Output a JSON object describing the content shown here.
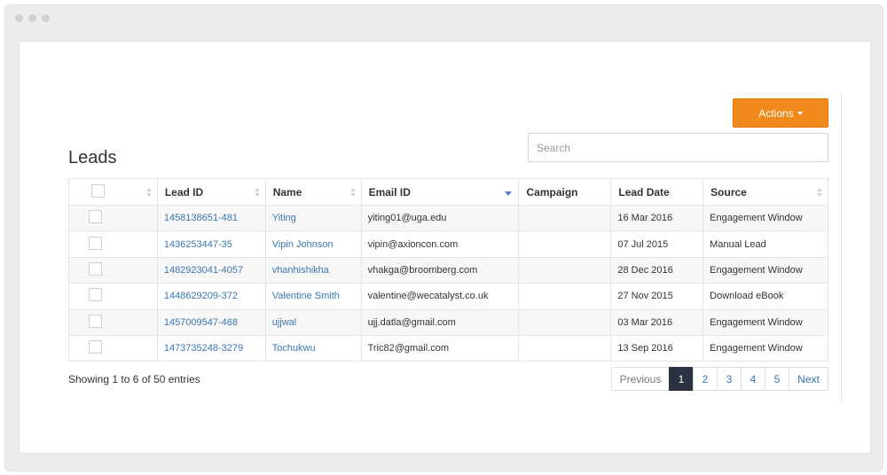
{
  "actions": {
    "label": "Actions"
  },
  "page": {
    "title": "Leads"
  },
  "search": {
    "placeholder": "Search",
    "value": ""
  },
  "table": {
    "columns": [
      "Lead ID",
      "Name",
      "Email ID",
      "Campaign",
      "Lead Date",
      "Source"
    ],
    "rows": [
      {
        "lead_id": "1458138651-481",
        "name": "Yiting",
        "email": "yiting01@uga.edu",
        "campaign": "",
        "date": "16 Mar 2016",
        "source": "Engagement Window"
      },
      {
        "lead_id": "1436253447-35",
        "name": "Vipin Johnson",
        "email": "vipin@axioncon.com",
        "campaign": "",
        "date": "07 Jul 2015",
        "source": "Manual Lead"
      },
      {
        "lead_id": "1482923041-4057",
        "name": "vhanhishikha",
        "email": "vhakga@broomberg.com",
        "campaign": "",
        "date": "28 Dec 2016",
        "source": "Engagement Window"
      },
      {
        "lead_id": "1448629209-372",
        "name": "Valentine Smith",
        "email": "valentine@wecatalyst.co.uk",
        "campaign": "",
        "date": "27 Nov 2015",
        "source": "Download eBook"
      },
      {
        "lead_id": "1457009547-468",
        "name": "ujjwal",
        "email": "ujj.datla@gmail.com",
        "campaign": "",
        "date": "03 Mar 2016",
        "source": "Engagement Window"
      },
      {
        "lead_id": "1473735248-3279",
        "name": "Tochukwu",
        "email": "Tric82@gmail.com",
        "campaign": "",
        "date": "13 Sep 2016",
        "source": "Engagement Window"
      }
    ]
  },
  "footer": {
    "entries_text": "Showing 1 to 6 of 50 entries"
  },
  "pagination": {
    "previous": "Previous",
    "pages": [
      "1",
      "2",
      "3",
      "4",
      "5"
    ],
    "active_page": "1",
    "next": "Next"
  },
  "colors": {
    "accent": "#f08a1c",
    "link": "#3a77b0",
    "active_page": "#2b3340",
    "sort_active": "#5a7bc6"
  },
  "icons": {
    "sort": "sort-icon",
    "sort_active": "sort-desc-icon",
    "dropdown": "caret-down-icon"
  }
}
